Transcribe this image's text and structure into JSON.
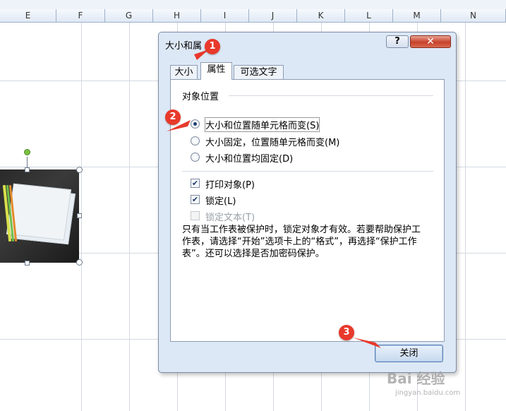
{
  "sheet": {
    "columns": [
      "E",
      "F",
      "G",
      "H",
      "I",
      "J",
      "K",
      "L",
      "M",
      "N"
    ]
  },
  "dialog": {
    "title": "大小和属",
    "help_label": "?",
    "close_label": "✕",
    "tabs": [
      {
        "label": "大小",
        "active": false
      },
      {
        "label": "属性",
        "active": true
      },
      {
        "label": "可选文字",
        "active": false
      }
    ],
    "group_title": "对象位置",
    "positioning": [
      {
        "label": "大小和位置随单元格而变(S)",
        "selected": true
      },
      {
        "label": "大小固定，位置随单元格而变(M)",
        "selected": false
      },
      {
        "label": "大小和位置均固定(D)",
        "selected": false
      }
    ],
    "checks": [
      {
        "label": "打印对象(P)",
        "checked": true,
        "enabled": true
      },
      {
        "label": "锁定(L)",
        "checked": true,
        "enabled": true
      },
      {
        "label": "锁定文本(T)",
        "checked": false,
        "enabled": false
      }
    ],
    "description": "只有当工作表被保护时，锁定对象才有效。若要帮助保护工作表，请选择“开始”选项卡上的“格式”，再选择“保护工作表”。还可以选择是否加密码保护。",
    "close_button": "关闭"
  },
  "annotations": [
    "1",
    "2",
    "3"
  ],
  "watermark": {
    "main": "Bai 经验",
    "sub": "jingyan.baidu.com"
  },
  "colors": {
    "accent_red": "#e8392b",
    "dialog_bg": "#dde8f6"
  }
}
